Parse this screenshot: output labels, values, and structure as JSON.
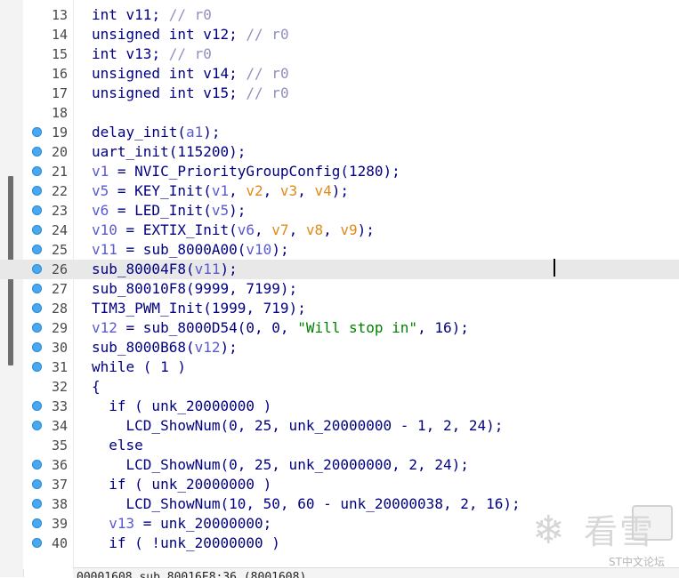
{
  "editor": {
    "current_line": "26",
    "lines": [
      {
        "num": "13",
        "bp": false,
        "tokens": [
          [
            "n",
            "int "
          ],
          [
            "n",
            "v11"
          ],
          [
            "n",
            "; "
          ],
          [
            "c",
            "// r0"
          ]
        ]
      },
      {
        "num": "14",
        "bp": false,
        "tokens": [
          [
            "n",
            "unsigned int "
          ],
          [
            "n",
            "v12"
          ],
          [
            "n",
            "; "
          ],
          [
            "c",
            "// r0"
          ]
        ]
      },
      {
        "num": "15",
        "bp": false,
        "tokens": [
          [
            "n",
            "int "
          ],
          [
            "n",
            "v13"
          ],
          [
            "n",
            "; "
          ],
          [
            "c",
            "// r0"
          ]
        ]
      },
      {
        "num": "16",
        "bp": false,
        "tokens": [
          [
            "n",
            "unsigned int "
          ],
          [
            "n",
            "v14"
          ],
          [
            "n",
            "; "
          ],
          [
            "c",
            "// r0"
          ]
        ]
      },
      {
        "num": "17",
        "bp": false,
        "tokens": [
          [
            "n",
            "unsigned int "
          ],
          [
            "n",
            "v15"
          ],
          [
            "n",
            "; "
          ],
          [
            "c",
            "// r0"
          ]
        ]
      },
      {
        "num": "18",
        "bp": false,
        "tokens": []
      },
      {
        "num": "19",
        "bp": true,
        "tokens": [
          [
            "n",
            "delay_init("
          ],
          [
            "v",
            "a1"
          ],
          [
            "n",
            ");"
          ]
        ]
      },
      {
        "num": "20",
        "bp": true,
        "tokens": [
          [
            "n",
            "uart_init(115200);"
          ]
        ]
      },
      {
        "num": "21",
        "bp": true,
        "tokens": [
          [
            "v",
            "v1"
          ],
          [
            "n",
            " = NVIC_PriorityGroupConfig(1280);"
          ]
        ]
      },
      {
        "num": "22",
        "bp": true,
        "tokens": [
          [
            "v",
            "v5"
          ],
          [
            "n",
            " = KEY_Init("
          ],
          [
            "v",
            "v1"
          ],
          [
            "n",
            ", "
          ],
          [
            "a",
            "v2"
          ],
          [
            "n",
            ", "
          ],
          [
            "a",
            "v3"
          ],
          [
            "n",
            ", "
          ],
          [
            "a",
            "v4"
          ],
          [
            "n",
            ");"
          ]
        ]
      },
      {
        "num": "23",
        "bp": true,
        "tokens": [
          [
            "v",
            "v6"
          ],
          [
            "n",
            " = LED_Init("
          ],
          [
            "v",
            "v5"
          ],
          [
            "n",
            ");"
          ]
        ]
      },
      {
        "num": "24",
        "bp": true,
        "tokens": [
          [
            "v",
            "v10"
          ],
          [
            "n",
            " = EXTIX_Init("
          ],
          [
            "v",
            "v6"
          ],
          [
            "n",
            ", "
          ],
          [
            "a",
            "v7"
          ],
          [
            "n",
            ", "
          ],
          [
            "a",
            "v8"
          ],
          [
            "n",
            ", "
          ],
          [
            "a",
            "v9"
          ],
          [
            "n",
            ");"
          ]
        ]
      },
      {
        "num": "25",
        "bp": true,
        "tokens": [
          [
            "v",
            "v11"
          ],
          [
            "n",
            " = sub_8000A00("
          ],
          [
            "v",
            "v10"
          ],
          [
            "n",
            ");"
          ]
        ]
      },
      {
        "num": "26",
        "bp": true,
        "tokens": [
          [
            "n",
            "sub_80004F8("
          ],
          [
            "v",
            "v11"
          ],
          [
            "n",
            ");"
          ]
        ]
      },
      {
        "num": "27",
        "bp": true,
        "tokens": [
          [
            "n",
            "sub_80010F8(9999, 7199);"
          ]
        ]
      },
      {
        "num": "28",
        "bp": true,
        "tokens": [
          [
            "n",
            "TIM3_PWM_Init(1999, 719);"
          ]
        ]
      },
      {
        "num": "29",
        "bp": true,
        "tokens": [
          [
            "v",
            "v12"
          ],
          [
            "n",
            " = sub_8000D54(0, 0, "
          ],
          [
            "s",
            "\"Will stop in\""
          ],
          [
            "n",
            ", 16);"
          ]
        ]
      },
      {
        "num": "30",
        "bp": true,
        "tokens": [
          [
            "n",
            "sub_8000B68("
          ],
          [
            "v",
            "v12"
          ],
          [
            "n",
            ");"
          ]
        ]
      },
      {
        "num": "31",
        "bp": true,
        "tokens": [
          [
            "n",
            "while ( 1 )"
          ]
        ]
      },
      {
        "num": "32",
        "bp": false,
        "tokens": [
          [
            "n",
            "{"
          ]
        ]
      },
      {
        "num": "33",
        "bp": true,
        "tokens": [
          [
            "n",
            "  if ( unk_20000000 )"
          ]
        ]
      },
      {
        "num": "34",
        "bp": true,
        "tokens": [
          [
            "n",
            "    LCD_ShowNum(0, 25, unk_20000000 - 1, 2, 24);"
          ]
        ]
      },
      {
        "num": "35",
        "bp": false,
        "tokens": [
          [
            "n",
            "  else"
          ]
        ]
      },
      {
        "num": "36",
        "bp": true,
        "tokens": [
          [
            "n",
            "    LCD_ShowNum(0, 25, unk_20000000, 2, 24);"
          ]
        ]
      },
      {
        "num": "37",
        "bp": true,
        "tokens": [
          [
            "n",
            "  if ( unk_20000000 )"
          ]
        ]
      },
      {
        "num": "38",
        "bp": true,
        "tokens": [
          [
            "n",
            "    LCD_ShowNum(10, 50, 60 - unk_20000038, 2, 16);"
          ]
        ]
      },
      {
        "num": "39",
        "bp": true,
        "tokens": [
          [
            "n",
            "  "
          ],
          [
            "v",
            "v13"
          ],
          [
            "n",
            " = unk_20000000;"
          ]
        ]
      },
      {
        "num": "40",
        "bp": true,
        "tokens": [
          [
            "n",
            "  if ( !unk_20000000 )"
          ]
        ]
      }
    ]
  },
  "status": {
    "text": "00001608 sub_80016E8:36 (8001608)"
  },
  "watermark": {
    "flake": "❄",
    "chars": "看雪",
    "caption": "ST中文论坛"
  },
  "colors": {
    "breakpoint": "#4aa8f0",
    "normal": "#000080",
    "variable": "#5a5ad0",
    "argument": "#e08a18",
    "string": "#008000",
    "comment": "#9090c0",
    "current_line_bg": "#e8e8e8"
  }
}
